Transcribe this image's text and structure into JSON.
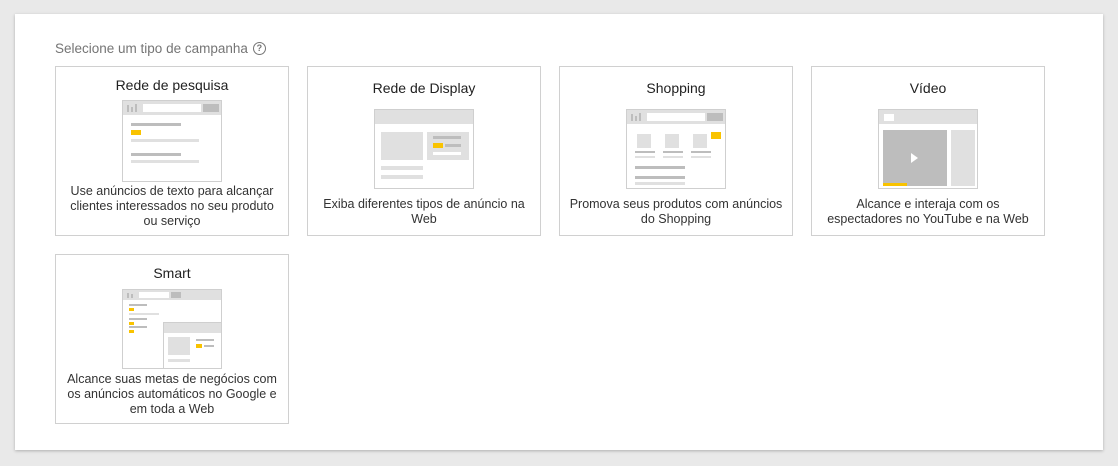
{
  "prompt": {
    "label": "Selecione um tipo de campanha",
    "help_icon": "help-circle-icon"
  },
  "accent_color": "#f9c300",
  "cards": [
    {
      "id": "search",
      "title": "Rede de pesquisa",
      "description": "Use anúncios de texto para alcançar clientes interessados no seu produto ou serviço"
    },
    {
      "id": "display",
      "title": "Rede de Display",
      "description": "Exiba diferentes tipos de anúncio na Web"
    },
    {
      "id": "shopping",
      "title": "Shopping",
      "description": "Promova seus produtos com anúncios do Shopping"
    },
    {
      "id": "video",
      "title": "Vídeo",
      "description": "Alcance e interaja com os espectadores no YouTube e na Web"
    },
    {
      "id": "smart",
      "title": "Smart",
      "description": "Alcance suas metas de negócios com os anúncios automáticos no Google e em toda a Web"
    }
  ]
}
